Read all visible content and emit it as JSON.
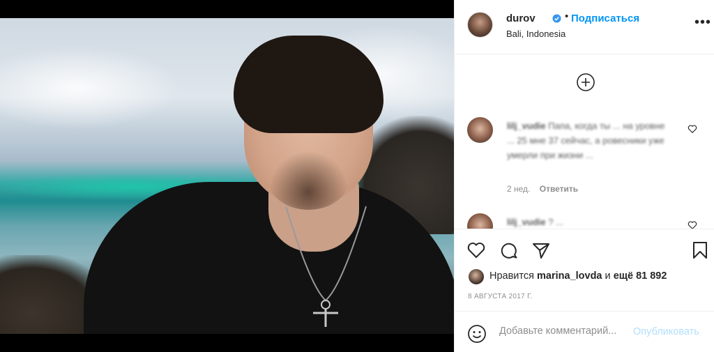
{
  "post": {
    "username": "durov",
    "follow_label": "Подписаться",
    "location": "Bali, Indonesia",
    "more_label": "•••",
    "separator": "•"
  },
  "comments": [
    {
      "username": "lilj_vudie",
      "text": "Папа, когда ты ... на уровне ... 25 мне 37 сейчас, а ровесники уже умерли при жизни ...",
      "age": "2 нед.",
      "reply_label": "Ответить"
    },
    {
      "username": "lilj_vudie",
      "text": "? ...",
      "age": "",
      "reply_label": ""
    }
  ],
  "likes": {
    "prefix": "Нравится",
    "user": "marina_lovda",
    "conjunction": "и",
    "others": "ещё 81 892"
  },
  "date": "8 АВГУСТА 2017 Г.",
  "comment_box": {
    "placeholder": "Добавьте комментарий...",
    "publish_label": "Опубликовать"
  },
  "colors": {
    "accent": "#0095f6",
    "publish_disabled": "#b2dffc",
    "text": "#262626",
    "muted": "#8e8e8e"
  },
  "icons": [
    "verified-badge-icon",
    "plus-circle-icon",
    "heart-icon",
    "comment-icon",
    "share-icon",
    "bookmark-icon",
    "emoji-icon"
  ]
}
